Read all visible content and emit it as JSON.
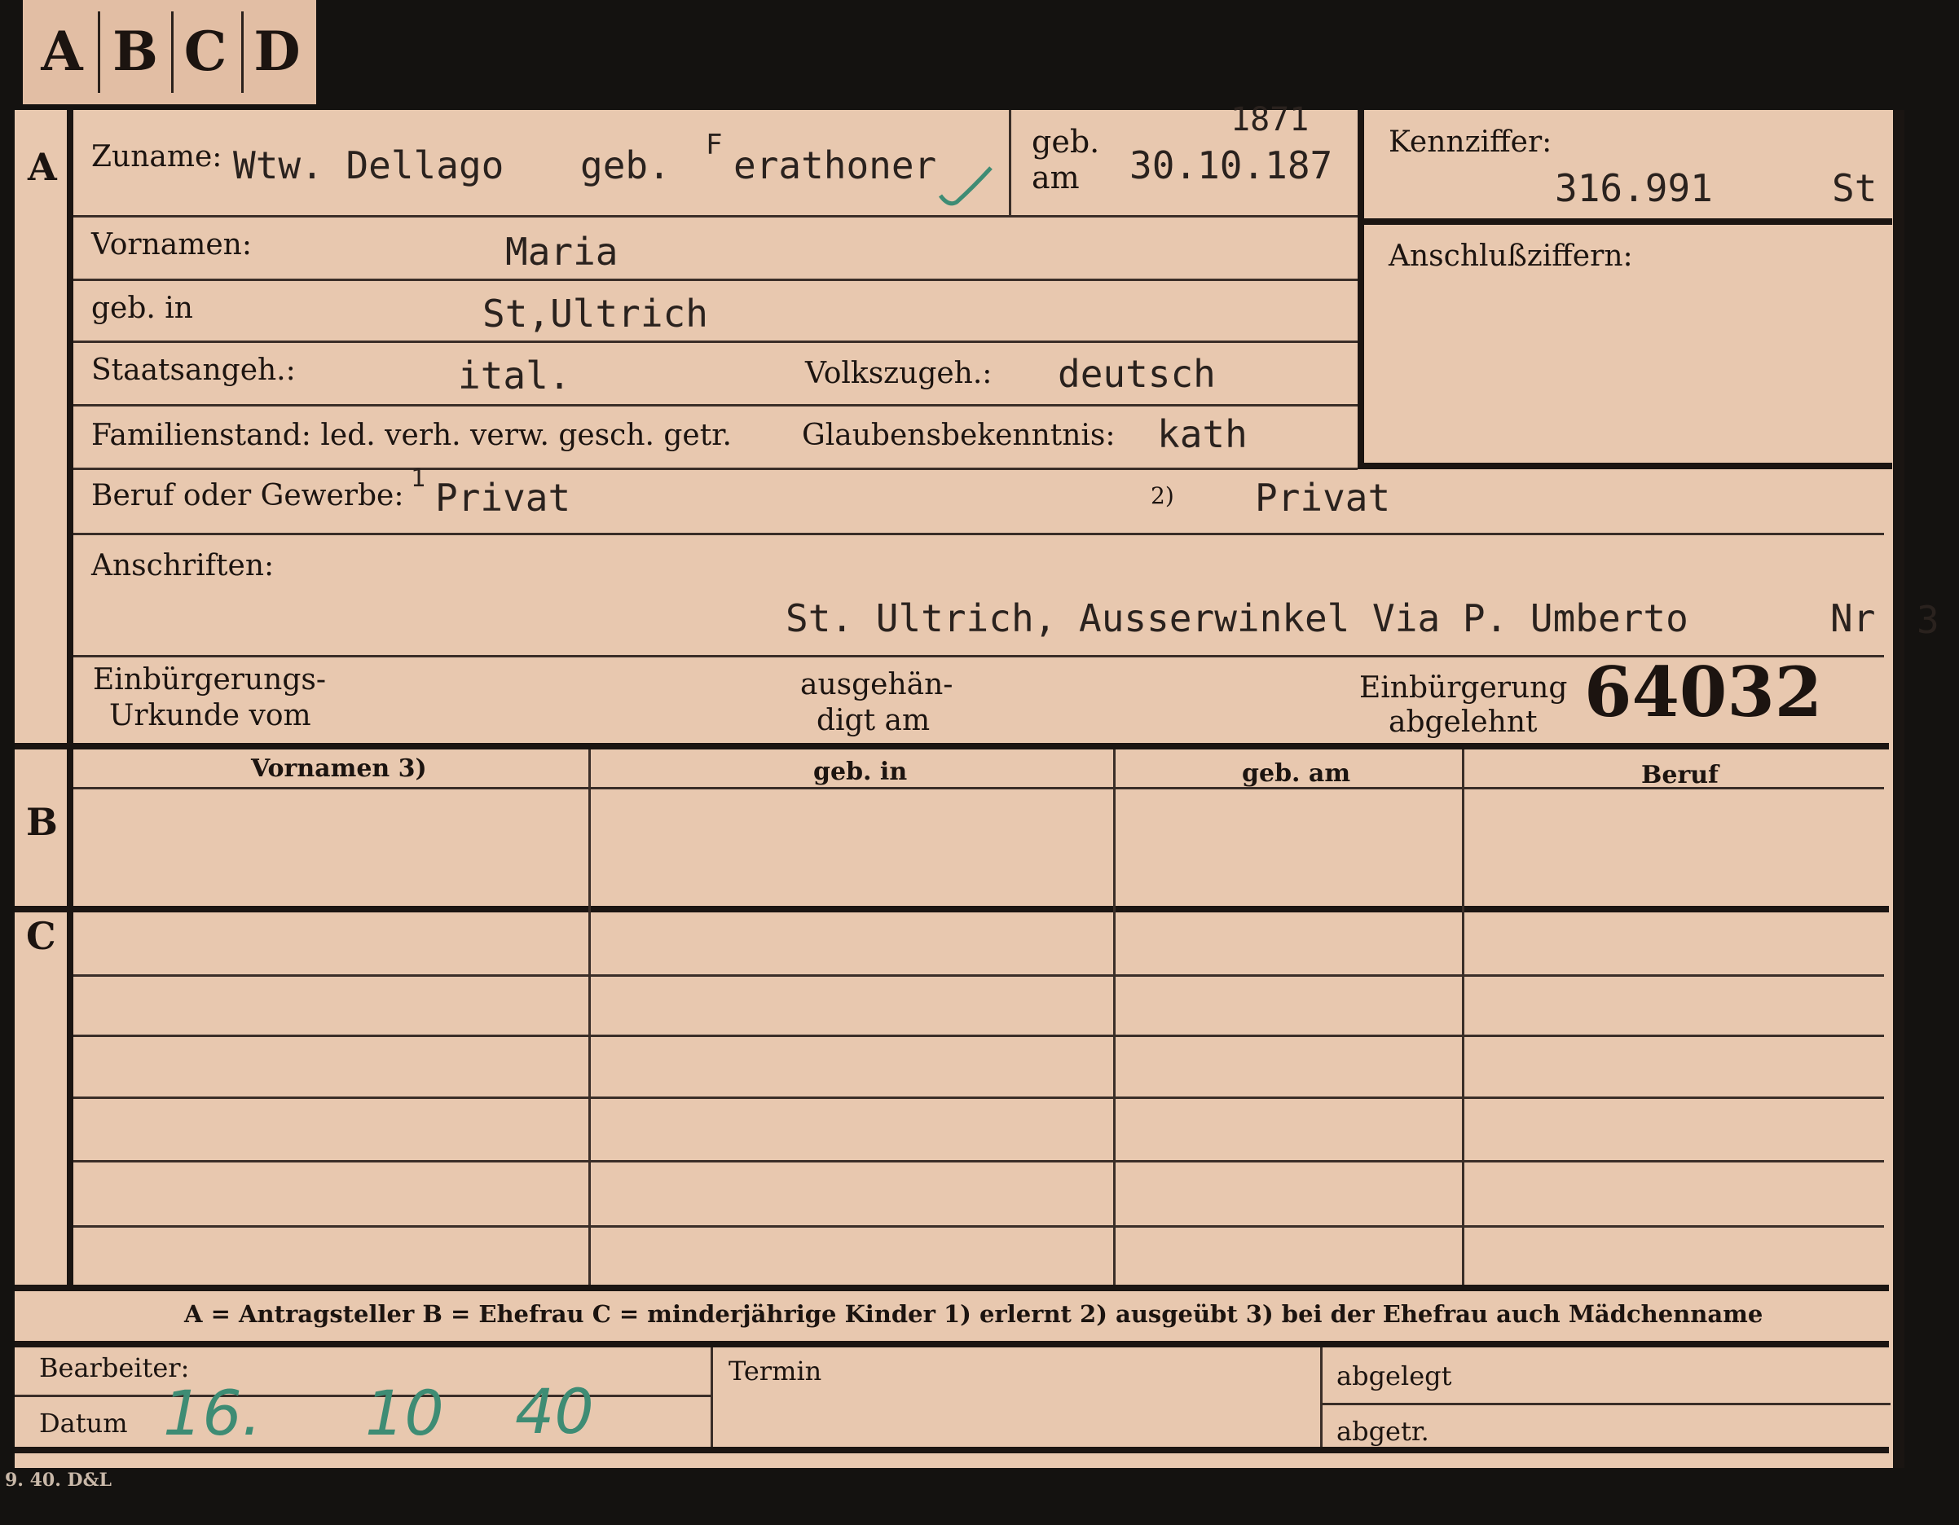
{
  "tabs": [
    "A",
    "B",
    "C",
    "D"
  ],
  "sections": {
    "a": "A",
    "b": "B",
    "c": "C"
  },
  "header": {
    "zuname_label": "Zuname:",
    "zuname_value": "Wtw. Dellago",
    "geb_prefix": "geb.",
    "maiden_value": "erathoner",
    "maiden_mark": "F",
    "geb_am_label_1": "geb.",
    "geb_am_label_2": "am",
    "birth_year_correction": "1871",
    "birth_date": "30.10.187",
    "kennziffer_label": "Kennziffer:",
    "kennziffer_value": "316.991",
    "kennziffer_suffix": "St",
    "anschluss_label": "Anschlußziffern:"
  },
  "fields": {
    "vornamen_label": "Vornamen:",
    "vornamen_value": "Maria",
    "geb_in_label": "geb. in",
    "geb_in_value": "St,Ultrich",
    "staatsangeh_label": "Staatsangeh.:",
    "staatsangeh_value": "ital.",
    "volkszugeh_label": "Volkszugeh.:",
    "volkszugeh_value": "deutsch",
    "familienstand_label": "Familienstand: led. verh. verw. gesch. getr.",
    "glauben_label": "Glaubensbekenntnis:",
    "glauben_value": "kath",
    "beruf_label": "Beruf oder Gewerbe:",
    "beruf_mark": "1",
    "beruf_value1": "Privat",
    "beruf_note2": "2)",
    "beruf_value2": "Privat",
    "anschriften_label": "Anschriften:",
    "anschriften_value": "St. Ultrich, Ausserwinkel Via P. Umberto",
    "anschriften_nr": "Nr",
    "anschriften_num": "3",
    "urkunde_label_1": "Einbürgerungs-",
    "urkunde_label_2": "Urkunde vom",
    "ausgehaendigt_1": "ausgehän-",
    "ausgehaendigt_2": "digt am",
    "abgelehnt_1": "Einbürgerung",
    "abgelehnt_2": "abgelehnt",
    "file_number": "64032"
  },
  "table": {
    "headers": [
      "Vornamen 3)",
      "geb. in",
      "geb. am",
      "Beruf"
    ]
  },
  "legend": "A = Antragsteller   B = Ehefrau   C = minderjährige Kinder   1) erlernt   2) ausgeübt   3) bei der Ehefrau auch Mädchenname",
  "footer": {
    "bearbeiter_label": "Bearbeiter:",
    "datum_label": "Datum",
    "datum_value_day": "16.",
    "datum_value_month": "10",
    "datum_value_year": "40",
    "termin_label": "Termin",
    "abgelegt_label": "abgelegt",
    "abgetr_label": "abgetr.",
    "print_code": "9. 40. D&L"
  },
  "colors": {
    "card": "#e8c8af",
    "ink": "#1c1410",
    "handwriting": "#3e8c74",
    "background": "#141210"
  }
}
